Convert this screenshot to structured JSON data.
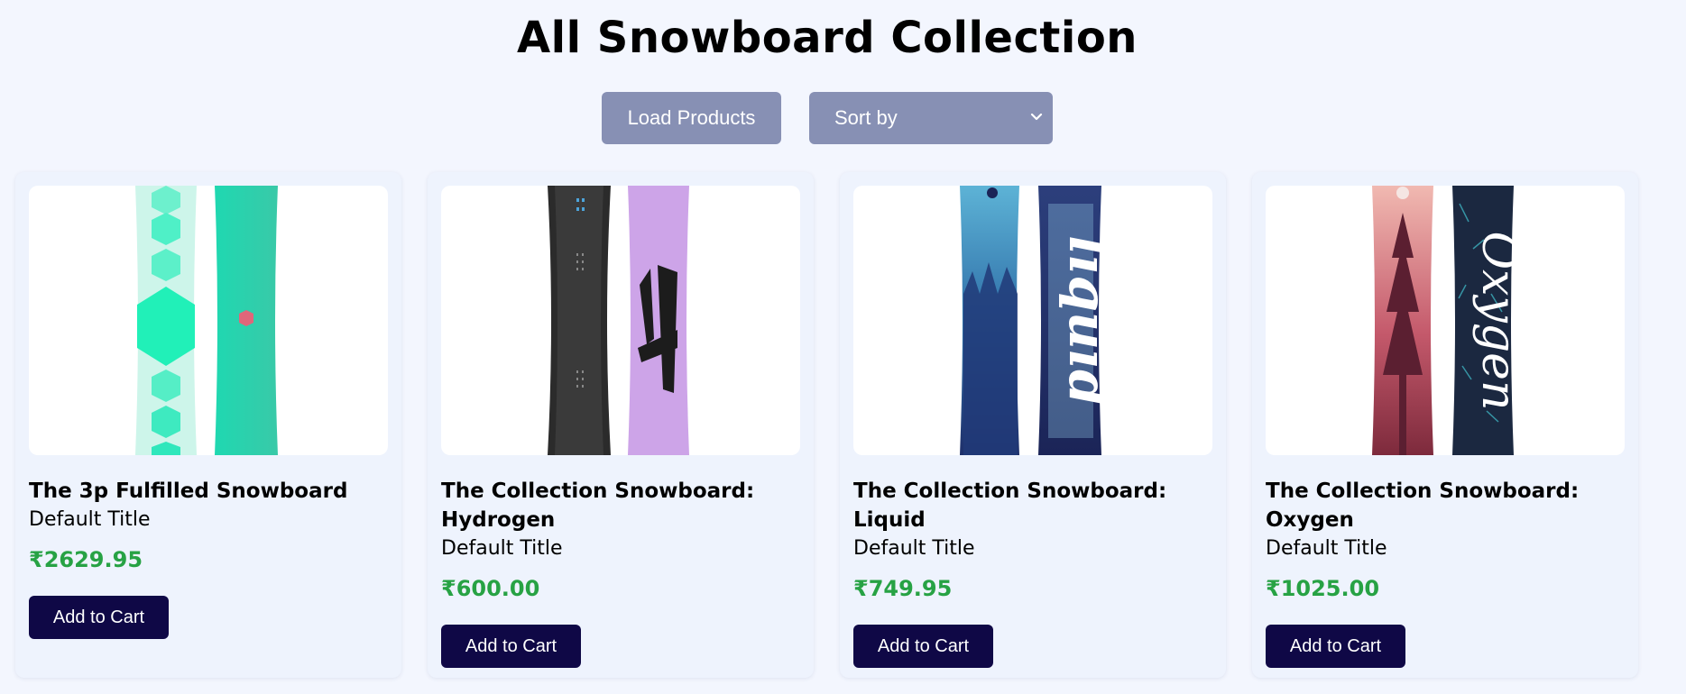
{
  "page": {
    "title": "All Snowboard Collection"
  },
  "controls": {
    "load_label": "Load Products",
    "sort_label": "Sort by"
  },
  "products": [
    {
      "name": "The 3p Fulfilled Snowboard",
      "variant": "Default Title",
      "price": "₹2629.95",
      "cart_label": "Add to Cart"
    },
    {
      "name": "The Collection Snowboard: Hydrogen",
      "variant": "Default Title",
      "price": "₹600.00",
      "cart_label": "Add to Cart"
    },
    {
      "name": "The Collection Snowboard: Liquid",
      "variant": "Default Title",
      "price": "₹749.95",
      "cart_label": "Add to Cart"
    },
    {
      "name": "The Collection Snowboard: Oxygen",
      "variant": "Default Title",
      "price": "₹1025.00",
      "cart_label": "Add to Cart"
    }
  ],
  "colors": {
    "background": "#f3f6fe",
    "control_button": "#8790b4",
    "cart_button": "#0f0846",
    "price": "#27a244"
  },
  "icons": {
    "sort_chevron": "chevron-down-icon"
  }
}
